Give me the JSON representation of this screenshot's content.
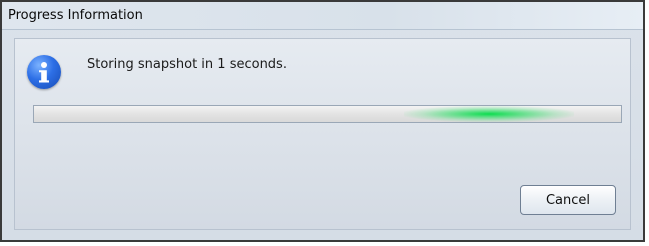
{
  "window": {
    "title": "Progress Information"
  },
  "dialog": {
    "icon": "info-icon",
    "message": "Storing snapshot in 1 seconds.",
    "progress": {
      "mode": "indeterminate",
      "accent": "#00DC46"
    },
    "buttons": {
      "cancel_label": "Cancel"
    }
  }
}
